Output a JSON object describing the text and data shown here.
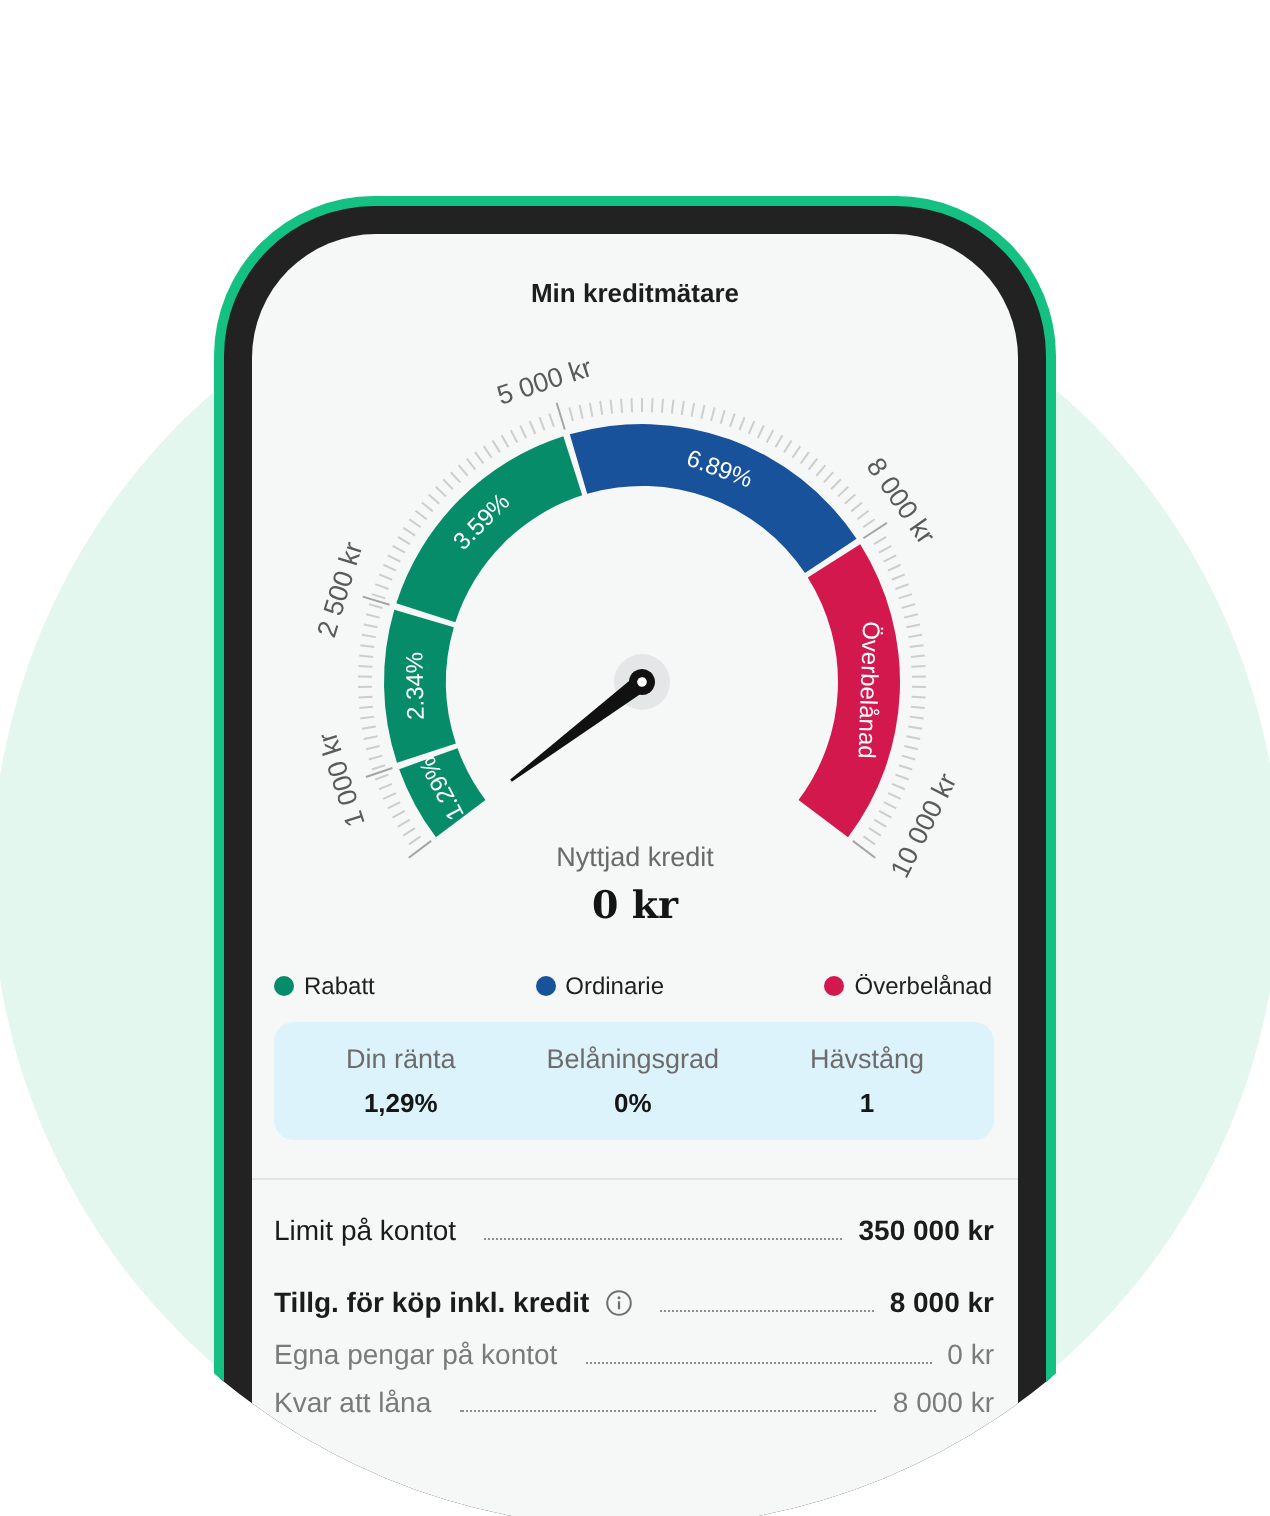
{
  "header": {
    "title": "Min kreditmätare"
  },
  "gauge": {
    "scale_labels": [
      "1 000 kr",
      "2 500 kr",
      "5 000 kr",
      "8 000 kr",
      "10 000 kr"
    ],
    "segments": [
      {
        "label": "1.29%",
        "color": "#078c69"
      },
      {
        "label": "2.34%",
        "color": "#078c69"
      },
      {
        "label": "3.59%",
        "color": "#078c69"
      },
      {
        "label": "6.89%",
        "color": "#17529a"
      },
      {
        "label": "Överbelånad",
        "color": "#d3184e"
      }
    ],
    "caption": "Nyttjad kredit",
    "value": "0 kr"
  },
  "legend": [
    {
      "label": "Rabatt",
      "color": "#078c69"
    },
    {
      "label": "Ordinarie",
      "color": "#17529a"
    },
    {
      "label": "Överbelånad",
      "color": "#d3184e"
    }
  ],
  "stats": [
    {
      "label": "Din ränta",
      "value": "1,29%"
    },
    {
      "label": "Belåningsgrad",
      "value": "0%"
    },
    {
      "label": "Hävstång",
      "value": "1"
    }
  ],
  "rows": [
    {
      "kind": "standard",
      "label": "Limit på kontot",
      "value": "350 000 kr",
      "info": false
    },
    {
      "kind": "bold",
      "label": "Tillg. för köp inkl. kredit",
      "value": "8 000 kr",
      "info": true
    },
    {
      "kind": "muted",
      "label": "Egna pengar på kontot",
      "value": "0 kr",
      "info": false
    },
    {
      "kind": "muted",
      "label": "Kvar att låna",
      "value": "8 000 kr",
      "info": false
    }
  ]
}
